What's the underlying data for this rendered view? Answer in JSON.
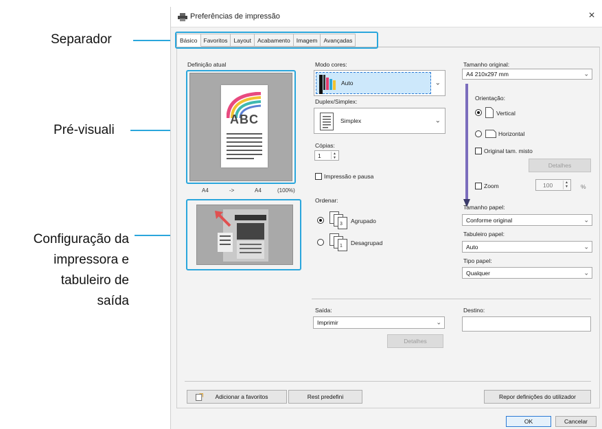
{
  "callouts": {
    "separador": "Separador",
    "pre_visual": "Pré-visuali",
    "config_line1": "Configuração da",
    "config_line2": "impressora e",
    "config_line3": "tabuleiro de",
    "config_line4": "saída"
  },
  "window": {
    "title": "Preferências de impressão",
    "close": "×"
  },
  "tabs": [
    "Básico",
    "Favoritos",
    "Layout",
    "Acabamento",
    "Imagem",
    "Avançadas"
  ],
  "preview": {
    "label": "Definição atual",
    "paper_text": "ABC",
    "size_from": "A4",
    "arrow": "->",
    "size_to": "A4",
    "zoom": "(100%)"
  },
  "mode": {
    "label": "Modo cores:",
    "value": "Auto"
  },
  "duplex": {
    "label": "Duplex/Simplex:",
    "value": "Simplex"
  },
  "copies": {
    "label": "Cópias:",
    "value": "1"
  },
  "pause": {
    "label": "Impressão e pausa"
  },
  "order": {
    "label": "Ordenar:",
    "options": [
      "Agrupado",
      "Desagrupad"
    ]
  },
  "original_size": {
    "label": "Tamanho original:",
    "value": "A4 210x297 mm"
  },
  "orientation": {
    "label": "Orientação:",
    "options": [
      "Vertical",
      "Horizontal"
    ]
  },
  "mixed": {
    "label": "Original tam. misto",
    "details": "Detalhes"
  },
  "zoom": {
    "label": "Zoom",
    "value": "100",
    "unit": "%"
  },
  "paper_size": {
    "label": "Tamanho papel:",
    "value": "Conforme original"
  },
  "paper_tray": {
    "label": "Tabuleiro papel:",
    "value": "Auto"
  },
  "paper_type": {
    "label": "Tipo papel:",
    "value": "Qualquer"
  },
  "output": {
    "label": "Saída:",
    "value": "Imprimir",
    "details": "Detalhes"
  },
  "destination": {
    "label": "Destino:",
    "value": ""
  },
  "footer": {
    "add_favorites": "Adicionar a favoritos",
    "reset_default": "Rest predefini",
    "restore_user": "Repor definições do utilizador",
    "ok": "OK",
    "cancel": "Cancelar"
  },
  "colors": {
    "accent": "#2aa6dc",
    "selection": "#cde8fb"
  }
}
